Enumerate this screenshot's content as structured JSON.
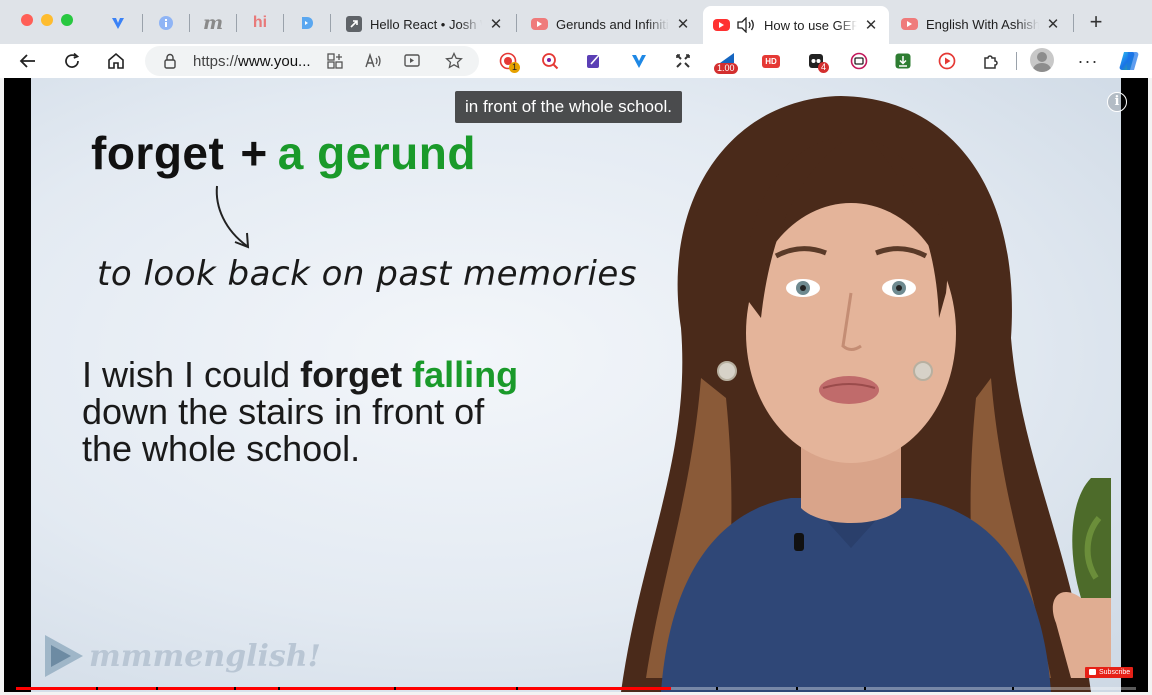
{
  "window": {
    "traffic_lights": [
      "close",
      "minimize",
      "zoom"
    ]
  },
  "pinned_tabs": [
    {
      "icon": "vee-icon",
      "color": "#3b82f6"
    },
    {
      "icon": "info-icon",
      "color": "#4f8ff7"
    },
    {
      "icon": "m-icon",
      "label": "m",
      "color": "#8a8a8a"
    },
    {
      "icon": "hi-icon",
      "label": "hi",
      "color": "#e87a7a"
    },
    {
      "icon": "d-icon",
      "color": "#5aa7f0"
    }
  ],
  "tabs": [
    {
      "title": "Hello React • Josh W",
      "icon": "arrow-icon",
      "active": false
    },
    {
      "title": "Gerunds and Infinitive",
      "icon": "youtube-icon",
      "active": false
    },
    {
      "title": "How to use GERUNDS",
      "icon": "youtube-icon",
      "active": true
    },
    {
      "title": "English With Ashish -",
      "icon": "youtube-icon",
      "active": false
    }
  ],
  "toolbar": {
    "url_prefix": "https://",
    "url_host": "www.you...",
    "extensions": [
      {
        "icon": "record-icon",
        "badge": "1",
        "color": "#e53935"
      },
      {
        "icon": "magnifier-icon",
        "badge": "",
        "color": "#e53935"
      },
      {
        "icon": "note-icon",
        "badge": "",
        "color": "#5b3fb5"
      },
      {
        "icon": "vee-icon",
        "badge": "",
        "color": "#1e88e5"
      },
      {
        "icon": "arrows-icon",
        "badge": "",
        "color": "#333333"
      },
      {
        "icon": "speed-icon",
        "badge": "1.00",
        "color": "#1565c0"
      },
      {
        "icon": "hd-icon",
        "badge": "",
        "label": "HD",
        "color": "#e53935"
      },
      {
        "icon": "dark-icon",
        "badge": "4",
        "color": "#222222"
      },
      {
        "icon": "screen-icon",
        "badge": "",
        "color": "#c2185b"
      },
      {
        "icon": "download-icon",
        "badge": "",
        "color": "#2e7d32"
      },
      {
        "icon": "play-icon",
        "badge": "",
        "color": "#e53935"
      },
      {
        "icon": "puzzle-icon",
        "badge": "",
        "color": "#333333"
      }
    ]
  },
  "video": {
    "caption": "in front of the whole school.",
    "slide": {
      "heading_word": "forget",
      "heading_plus": "+",
      "heading_green": "a gerund",
      "note": "to look back on past memories",
      "example_1a": "I wish I could ",
      "example_1b": "forget",
      "example_1c": " falling",
      "example_2": "down the stairs in front of",
      "example_3": "the whole school."
    },
    "logo_text": "mmmenglish!",
    "subscribe_label": "Subscribe",
    "info_label": "i",
    "progress": 0.585,
    "accent": "#ff0000",
    "green": "#1a9a2a"
  }
}
